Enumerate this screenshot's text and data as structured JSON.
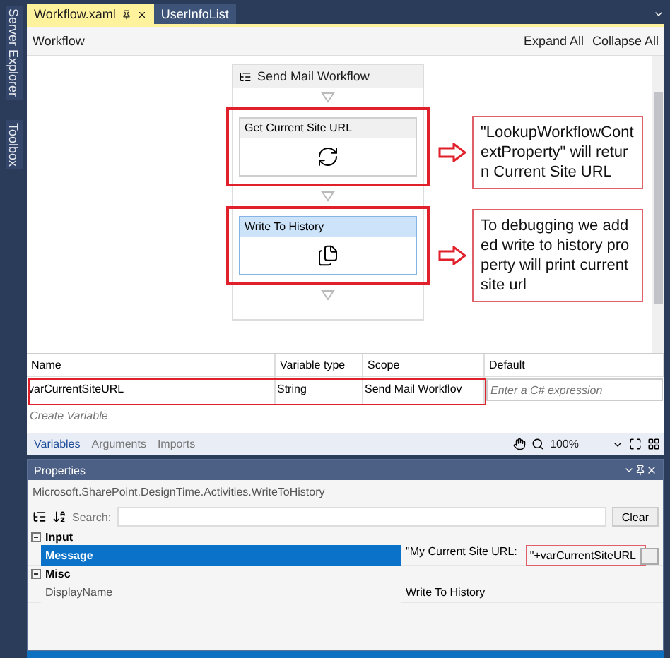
{
  "side_tabs": [
    {
      "label": "Server Explorer"
    },
    {
      "label": "Toolbox"
    }
  ],
  "tabs": [
    {
      "label": "Workflow.xaml",
      "selected": true
    },
    {
      "label": "UserInfoList",
      "selected": false
    }
  ],
  "designer": {
    "breadcrumb": "Workflow",
    "expand_all": "Expand All",
    "collapse_all": "Collapse All"
  },
  "sequence": {
    "title": "Send Mail Workflow",
    "activities": [
      {
        "title": "Get Current Site URL",
        "selected": false,
        "kind": "lookup",
        "note": "\"LookupWorkflowContextProperty\" will return Current Site URL"
      },
      {
        "title": "Write To History",
        "selected": true,
        "kind": "history",
        "note": "To debugging we added write to history property will print current site url"
      }
    ]
  },
  "variables": {
    "columns": [
      "Name",
      "Variable type",
      "Scope",
      "Default"
    ],
    "rows": [
      {
        "name": "varCurrentSiteURL",
        "type": "String",
        "scope": "Send Mail Workflov",
        "default_placeholder": "Enter a C# expression"
      }
    ],
    "create": "Create Variable",
    "tabs": [
      {
        "label": "Variables",
        "selected": true
      },
      {
        "label": "Arguments",
        "selected": false
      },
      {
        "label": "Imports",
        "selected": false
      }
    ],
    "zoom": "100%"
  },
  "properties": {
    "title": "Properties",
    "type_name": "Microsoft.SharePoint.DesignTime.Activities.WriteToHistory",
    "search_label": "Search:",
    "clear": "Clear",
    "categories": [
      {
        "name": "Input",
        "expanded": true,
        "items": [
          {
            "name": "Message",
            "value_start": "\"My Current Site URL:",
            "value_end": " \"+varCurrentSiteURL",
            "selected": true,
            "has_button": true
          }
        ]
      },
      {
        "name": "Misc",
        "expanded": true,
        "items": [
          {
            "name": "DisplayName",
            "value_start": "Write To History",
            "selected": false,
            "has_button": false
          }
        ]
      }
    ]
  }
}
